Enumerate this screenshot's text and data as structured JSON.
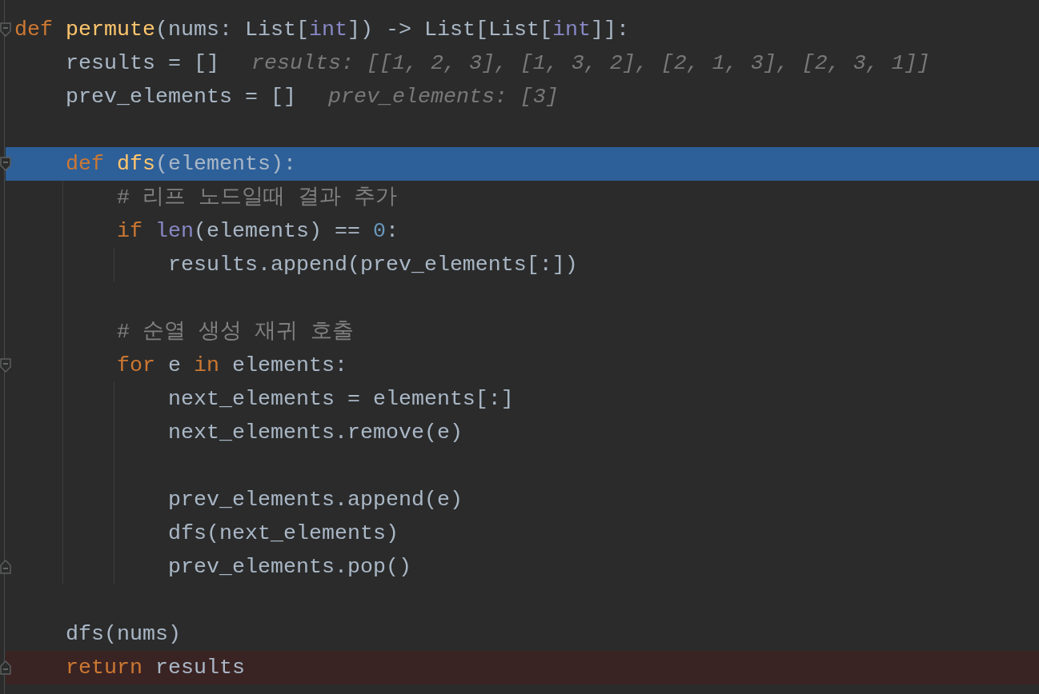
{
  "editor": {
    "lines": [
      {
        "kind": "opener",
        "selected": false,
        "error": false,
        "tokens": [
          {
            "kind": "keyword",
            "text": "def "
          },
          {
            "kind": "function",
            "text": "permute"
          },
          {
            "kind": "plain",
            "text": "(nums: List["
          },
          {
            "kind": "builtin",
            "text": "int"
          },
          {
            "kind": "plain",
            "text": "]) -> List[List["
          },
          {
            "kind": "builtin",
            "text": "int"
          },
          {
            "kind": "plain",
            "text": "]]:"
          }
        ]
      },
      {
        "kind": "plain",
        "selected": false,
        "error": false,
        "tokens": [
          {
            "kind": "plain",
            "text": "    results = []"
          }
        ],
        "hint": "results: [[1, 2, 3], [1, 3, 2], [2, 1, 3], [2, 3, 1]]"
      },
      {
        "kind": "plain",
        "selected": false,
        "error": false,
        "tokens": [
          {
            "kind": "plain",
            "text": "    prev_elements = []"
          }
        ],
        "hint": "prev_elements: [3]"
      },
      {
        "kind": "plain",
        "selected": false,
        "error": false
      },
      {
        "kind": "opener",
        "selected": true,
        "error": false,
        "tokens": [
          {
            "kind": "keyword",
            "text": "    def "
          },
          {
            "kind": "function",
            "text": "dfs"
          },
          {
            "kind": "plain",
            "text": "(elements):"
          }
        ]
      },
      {
        "kind": "plain",
        "selected": false,
        "error": false,
        "tokens": [
          {
            "kind": "comment",
            "text": "        # 리프 노드일때 결과 추가"
          }
        ]
      },
      {
        "kind": "plain",
        "selected": false,
        "error": false,
        "tokens": [
          {
            "kind": "keyword",
            "text": "        if "
          },
          {
            "kind": "builtin",
            "text": "len"
          },
          {
            "kind": "plain",
            "text": "(elements) == "
          },
          {
            "kind": "number",
            "text": "0"
          },
          {
            "kind": "plain",
            "text": ":"
          }
        ]
      },
      {
        "kind": "plain",
        "selected": false,
        "error": false,
        "tokens": [
          {
            "kind": "plain",
            "text": "            results.append(prev_elements[:])"
          }
        ]
      },
      {
        "kind": "plain",
        "selected": false,
        "error": false
      },
      {
        "kind": "plain",
        "selected": false,
        "error": false,
        "tokens": [
          {
            "kind": "comment",
            "text": "        # 순열 생성 재귀 호출"
          }
        ]
      },
      {
        "kind": "opener",
        "selected": false,
        "error": false,
        "tokens": [
          {
            "kind": "keyword",
            "text": "        for "
          },
          {
            "kind": "plain",
            "text": "e "
          },
          {
            "kind": "keyword",
            "text": "in "
          },
          {
            "kind": "plain",
            "text": "elements:"
          }
        ]
      },
      {
        "kind": "plain",
        "selected": false,
        "error": false,
        "tokens": [
          {
            "kind": "plain",
            "text": "            next_elements = elements[:]"
          }
        ]
      },
      {
        "kind": "plain",
        "selected": false,
        "error": false,
        "tokens": [
          {
            "kind": "plain",
            "text": "            next_elements.remove(e)"
          }
        ]
      },
      {
        "kind": "plain",
        "selected": false,
        "error": false
      },
      {
        "kind": "plain",
        "selected": false,
        "error": false,
        "tokens": [
          {
            "kind": "plain",
            "text": "            prev_elements.append(e)"
          }
        ]
      },
      {
        "kind": "plain",
        "selected": false,
        "error": false,
        "tokens": [
          {
            "kind": "plain",
            "text": "            dfs(next_elements)"
          }
        ]
      },
      {
        "kind": "closer",
        "selected": false,
        "error": false,
        "tokens": [
          {
            "kind": "plain",
            "text": "            prev_elements.pop()"
          }
        ]
      },
      {
        "kind": "plain",
        "selected": false,
        "error": false
      },
      {
        "kind": "plain",
        "selected": false,
        "error": false,
        "tokens": [
          {
            "kind": "plain",
            "text": "    dfs(nums)"
          }
        ]
      },
      {
        "kind": "closer",
        "selected": false,
        "error": true,
        "tokens": [
          {
            "kind": "keyword",
            "text": "    return "
          },
          {
            "kind": "plain",
            "text": "results"
          }
        ]
      }
    ]
  }
}
